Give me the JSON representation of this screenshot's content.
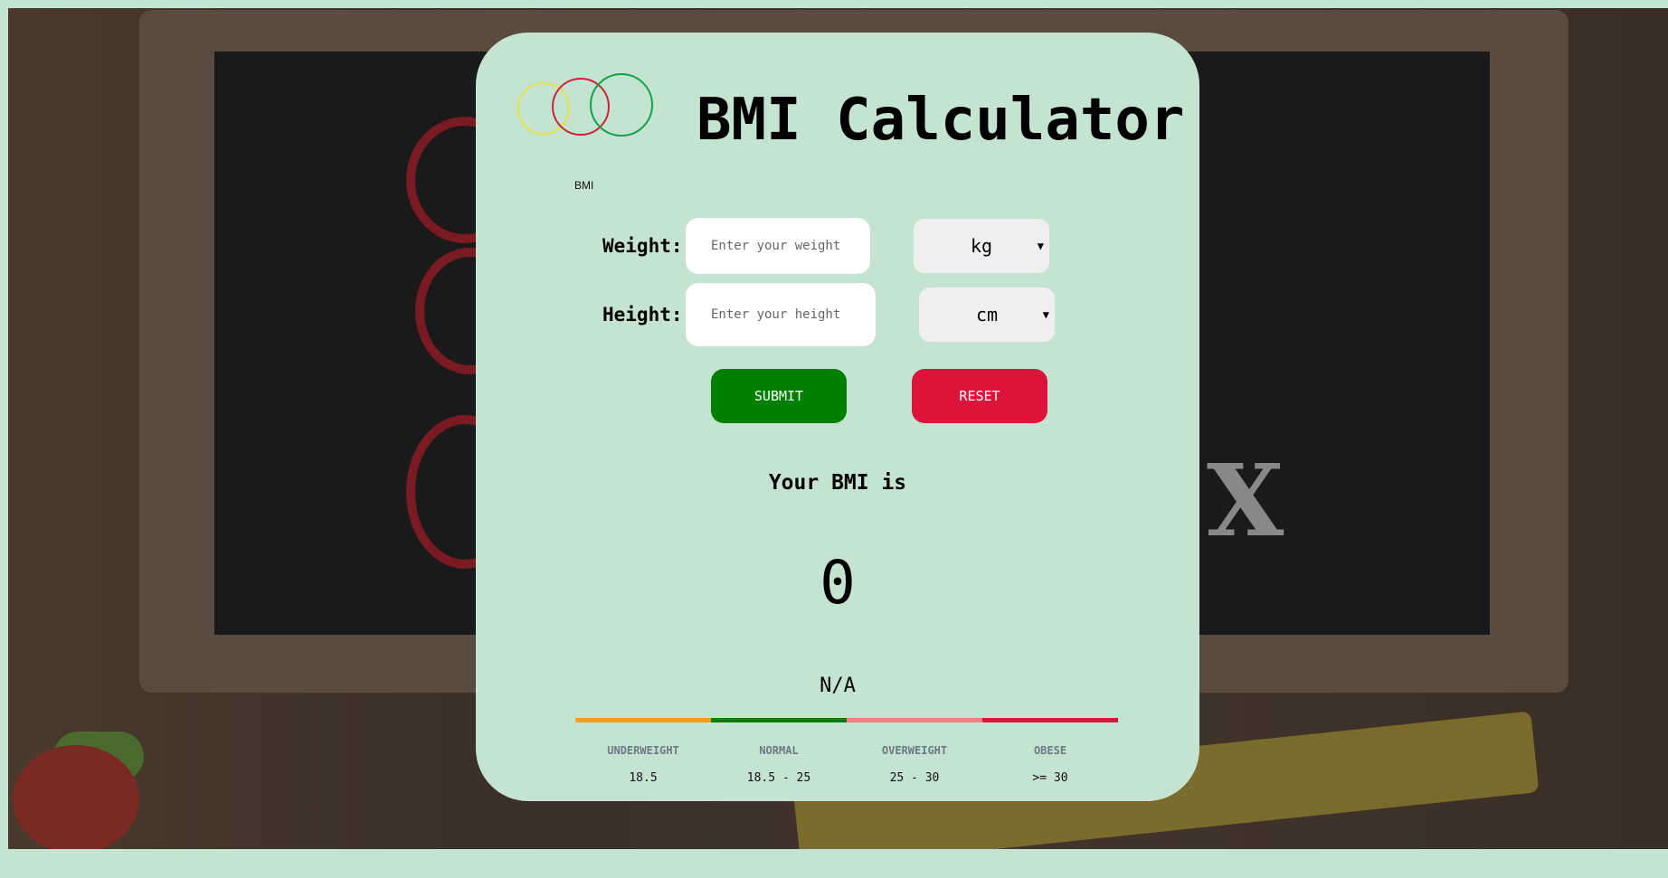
{
  "logo": {
    "caption": "BMI",
    "icon": "overlapping-circles-logo"
  },
  "title": "BMI Calculator",
  "form": {
    "weight_label": "Weight:",
    "weight_placeholder": "Enter your weight",
    "weight_unit": "kg",
    "height_label": "Height:",
    "height_placeholder": "Enter your height",
    "height_unit": "cm",
    "submit_label": "SUBMIT",
    "reset_label": "RESET"
  },
  "result": {
    "label": "Your BMI is",
    "value": "0",
    "category": "N/A"
  },
  "scale": {
    "ranges": [
      {
        "name": "UNDERWEIGHT",
        "range": "18.5",
        "color": "#f0a01e"
      },
      {
        "name": "NORMAL",
        "range": "18.5 - 25",
        "color": "#008000"
      },
      {
        "name": "OVERWEIGHT",
        "range": "25 - 30",
        "color": "#f08080"
      },
      {
        "name": "OBESE",
        "range": ">= 30",
        "color": "#dc143c"
      }
    ]
  },
  "colors": {
    "card": "#c5e3d1",
    "submit": "#008000",
    "reset": "#dc143c"
  }
}
